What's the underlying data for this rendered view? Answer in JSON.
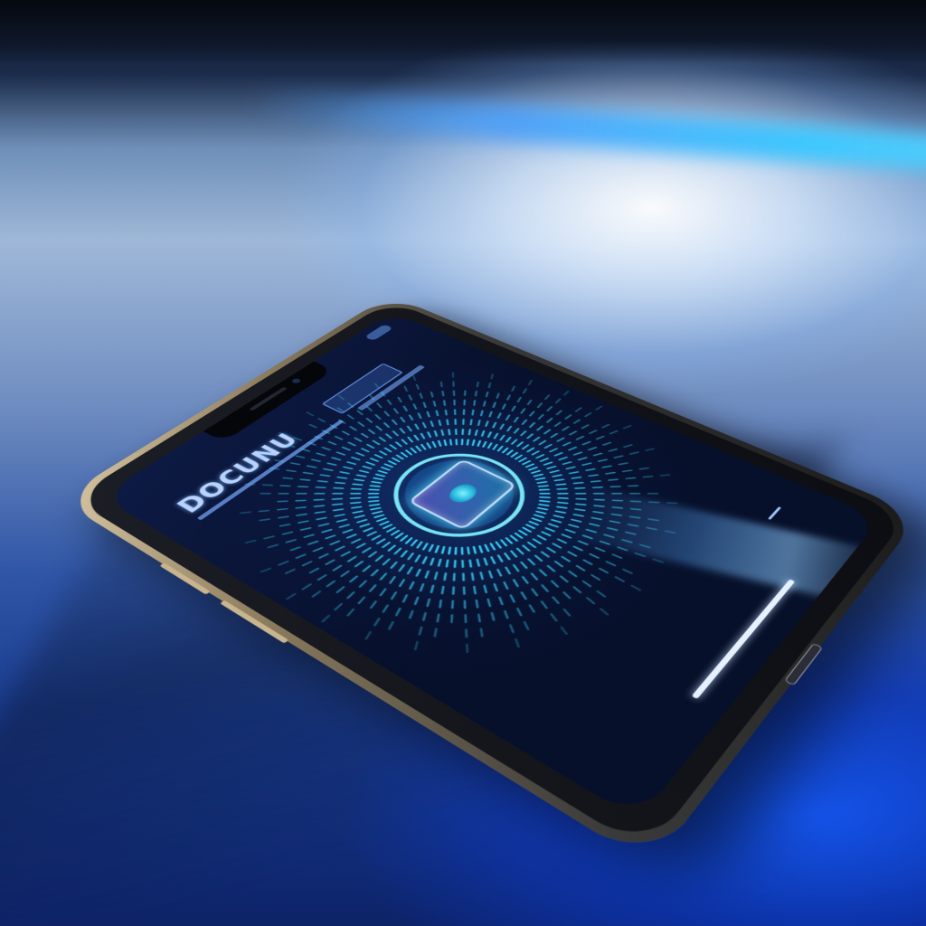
{
  "phone": {
    "app_title": "DOCUNU",
    "scanner_icon": "fingerprint-icon",
    "accent_color": "#3ad8ff",
    "background_glow_color": "#1e5bff"
  }
}
